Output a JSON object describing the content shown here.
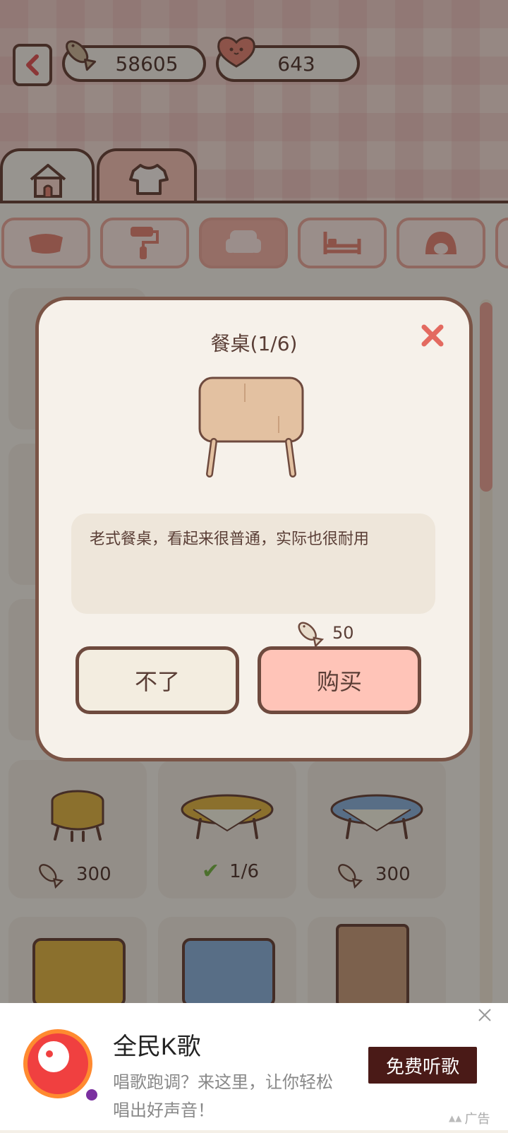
{
  "topbar": {
    "fish_count": "58605",
    "heart_count": "643"
  },
  "tabs": [
    {
      "icon": "house-icon"
    },
    {
      "icon": "shirt-icon"
    }
  ],
  "categories": [
    {
      "icon": "bowl-icon"
    },
    {
      "icon": "paint-roller-icon"
    },
    {
      "icon": "armchair-icon",
      "active": true
    },
    {
      "icon": "bed-icon"
    },
    {
      "icon": "cat-bed-icon"
    }
  ],
  "items": [
    {
      "icon": "stool-icon",
      "price": "300"
    },
    {
      "icon": "table-yellow-cloth-icon",
      "price": "1/6",
      "owned": true
    },
    {
      "icon": "table-blue-cloth-icon",
      "price": "300"
    }
  ],
  "dialog": {
    "title": "餐桌(1/6)",
    "description": "老式餐桌，看起来很普通，实际也很耐用",
    "price": "50",
    "cancel_label": "不了",
    "buy_label": "购买"
  },
  "ad": {
    "title": "全民K歌",
    "subtitle_line1": "唱歌跑调？来这里，让你轻松",
    "subtitle_line2": "唱出好声音！",
    "cta_label": "免费听歌",
    "tag": "广告"
  },
  "colors": {
    "accent": "#f0b2a5",
    "border": "#6e4a3e",
    "buy_button": "#ffc4b8",
    "cancel_button": "#f3ede0",
    "ad_cta": "#4a1a17"
  }
}
